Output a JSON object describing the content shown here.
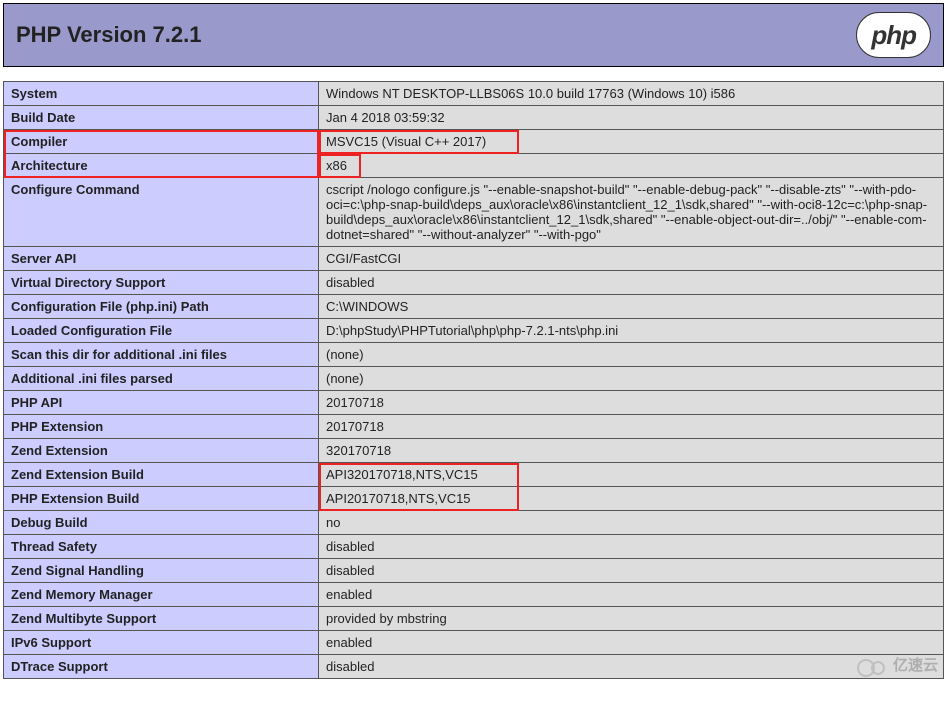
{
  "header": {
    "title": "PHP Version 7.2.1",
    "logo_text": "php"
  },
  "rows": [
    {
      "label": "System",
      "value": "Windows NT DESKTOP-LLBS06S 10.0 build 17763 (Windows 10) i586"
    },
    {
      "label": "Build Date",
      "value": "Jan 4 2018 03:59:32"
    },
    {
      "label": "Compiler",
      "value": "MSVC15 (Visual C++ 2017)"
    },
    {
      "label": "Architecture",
      "value": "x86"
    },
    {
      "label": "Configure Command",
      "value": "cscript /nologo configure.js \"--enable-snapshot-build\" \"--enable-debug-pack\" \"--disable-zts\" \"--with-pdo-oci=c:\\php-snap-build\\deps_aux\\oracle\\x86\\instantclient_12_1\\sdk,shared\" \"--with-oci8-12c=c:\\php-snap-build\\deps_aux\\oracle\\x86\\instantclient_12_1\\sdk,shared\" \"--enable-object-out-dir=../obj/\" \"--enable-com-dotnet=shared\" \"--without-analyzer\" \"--with-pgo\""
    },
    {
      "label": "Server API",
      "value": "CGI/FastCGI"
    },
    {
      "label": "Virtual Directory Support",
      "value": "disabled"
    },
    {
      "label": "Configuration File (php.ini) Path",
      "value": "C:\\WINDOWS"
    },
    {
      "label": "Loaded Configuration File",
      "value": "D:\\phpStudy\\PHPTutorial\\php\\php-7.2.1-nts\\php.ini"
    },
    {
      "label": "Scan this dir for additional .ini files",
      "value": "(none)"
    },
    {
      "label": "Additional .ini files parsed",
      "value": "(none)"
    },
    {
      "label": "PHP API",
      "value": "20170718"
    },
    {
      "label": "PHP Extension",
      "value": "20170718"
    },
    {
      "label": "Zend Extension",
      "value": "320170718"
    },
    {
      "label": "Zend Extension Build",
      "value": "API320170718,NTS,VC15"
    },
    {
      "label": "PHP Extension Build",
      "value": "API20170718,NTS,VC15"
    },
    {
      "label": "Debug Build",
      "value": "no"
    },
    {
      "label": "Thread Safety",
      "value": "disabled"
    },
    {
      "label": "Zend Signal Handling",
      "value": "disabled"
    },
    {
      "label": "Zend Memory Manager",
      "value": "enabled"
    },
    {
      "label": "Zend Multibyte Support",
      "value": "provided by mbstring"
    },
    {
      "label": "IPv6 Support",
      "value": "enabled"
    },
    {
      "label": "DTrace Support",
      "value": "disabled"
    }
  ],
  "watermark": {
    "text": "亿速云"
  }
}
